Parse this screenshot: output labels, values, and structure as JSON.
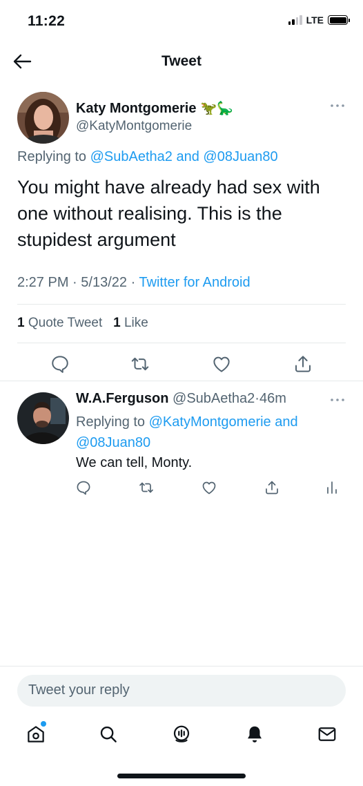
{
  "status_bar": {
    "time": "11:22",
    "network": "LTE"
  },
  "header": {
    "title": "Tweet",
    "back_icon": "arrow-left-icon"
  },
  "main_tweet": {
    "display_name": "Katy Montgomerie",
    "name_emojis": "🦖🦕",
    "handle": "@KatyMontgomerie",
    "replying_prefix": "Replying to",
    "replying_user1": "@SubAetha2",
    "replying_and": "and",
    "replying_user2": "@08Juan80",
    "text": "You might have already had sex with one without realising. This is the stupidest argument",
    "time": "2:27 PM",
    "date": "5/13/22",
    "source": "Twitter for Android",
    "quote_count": "1",
    "quote_label": "Quote Tweet",
    "like_count": "1",
    "like_label": "Like"
  },
  "reply_tweet": {
    "display_name": "W.A.Ferguson",
    "handle": "@SubAetha2",
    "age": "46m",
    "replying_prefix": "Replying to",
    "replying_user1": "@KatyMontgomerie",
    "replying_and": "and",
    "replying_user2": "@08Juan80",
    "text": "We can tell, Monty."
  },
  "composer": {
    "placeholder": "Tweet your reply"
  },
  "colors": {
    "accent": "#1d9bf0",
    "text": "#0f1419",
    "muted": "#536471"
  }
}
